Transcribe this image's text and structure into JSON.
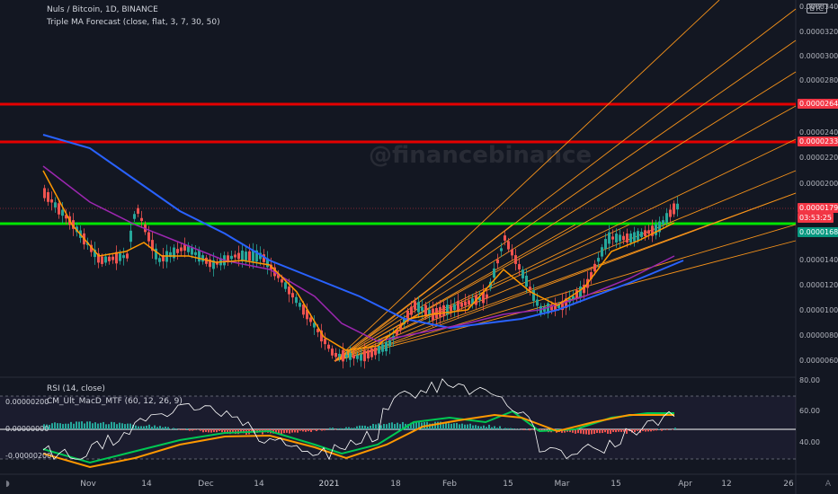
{
  "header": {
    "symbol_line": "Nuls / Bitcoin, 1D, BINANCE",
    "indicator_line": "Triple MA Forecast (close, flat, 3, 7, 30, 50)",
    "currency_badge": "BTC"
  },
  "watermark": "@financebinance",
  "price_axis": {
    "labels": [
      "0.00003400",
      "0.00003200",
      "0.00003000",
      "0.00002800",
      "0.00002400",
      "0.00002200",
      "0.00002000",
      "0.00001400",
      "0.00001200",
      "0.00001000",
      "0.00000800",
      "0.00000600"
    ]
  },
  "price_tags": [
    {
      "label": "0.00002643",
      "color": "#f23645"
    },
    {
      "label": "0.00002335",
      "color": "#f23645"
    },
    {
      "label": "0.00001792",
      "color": "#f23645"
    },
    {
      "label": "03:53:25",
      "color": "#f23645"
    },
    {
      "label": "0.00001688",
      "color": "#089981"
    }
  ],
  "rsi_pane": {
    "title": "RSI (14, close)",
    "macd_title": "CM_Ult_MacD_MTF (60, 12, 26, 9)",
    "rsi_labels": [
      "80.00",
      "60.00",
      "40.00"
    ],
    "macd_labels": [
      "0.00000200",
      "0.00000000",
      "-0.00000200"
    ]
  },
  "time_axis": {
    "labels": [
      "Nov",
      "14",
      "Dec",
      "14",
      "2021",
      "18",
      "Feb",
      "15",
      "Mar",
      "15",
      "Apr",
      "12",
      "26"
    ]
  },
  "colors": {
    "background": "#131722",
    "resistance": "#e50000",
    "support": "#00e600",
    "fan": "#f7931a",
    "ma_blue": "#2962ff",
    "ma_purple": "#9c27b0",
    "ma_orange": "#ff9800",
    "up": "#26a69a",
    "down": "#ef5350"
  },
  "icons": [
    "tradingview-logo-icon",
    "auto-scale-icon"
  ]
}
